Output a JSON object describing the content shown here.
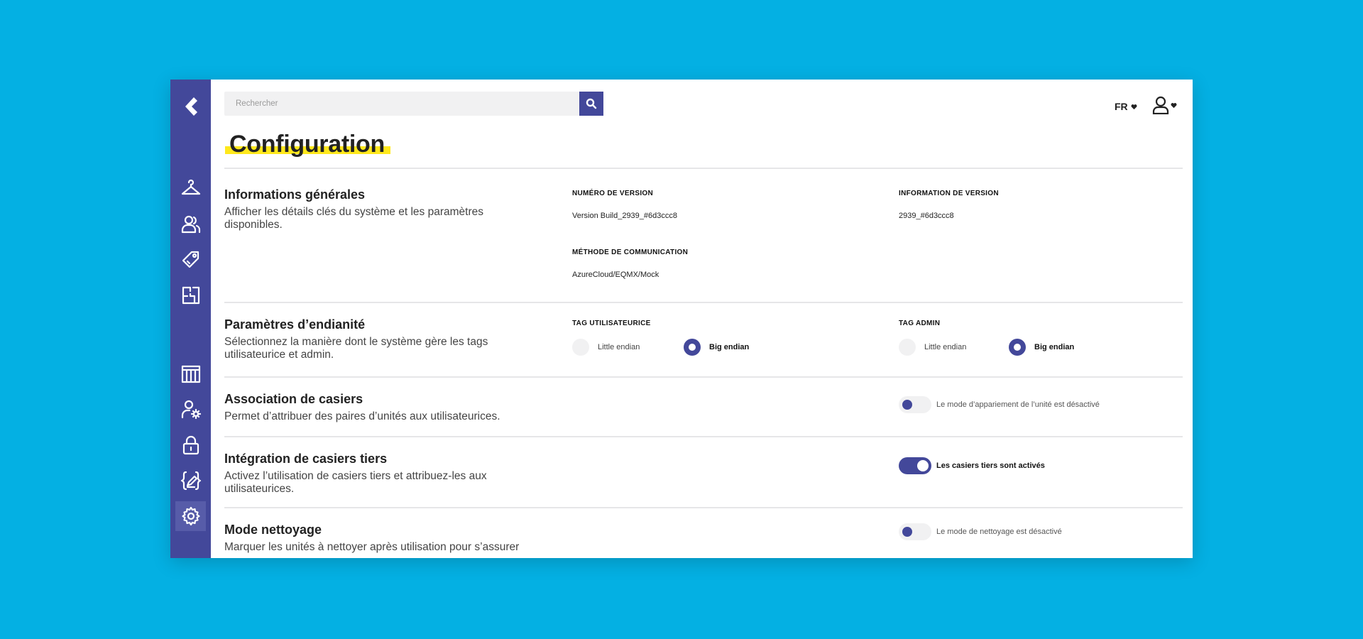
{
  "search": {
    "placeholder": "Rechercher"
  },
  "header": {
    "language": "FR"
  },
  "page": {
    "title": "Configuration"
  },
  "sections": {
    "general": {
      "title": "Informations générales",
      "description": "Afficher les détails clés du système et les paramètres disponibles.",
      "version_number_label": "NUMÉRO DE VERSION",
      "version_number_value": "Version Build_2939_#6d3ccc8",
      "version_info_label": "INFORMATION DE VERSION",
      "version_info_value": "2939_#6d3ccc8",
      "communication_label": "MÉTHODE DE COMMUNICATION",
      "communication_value": "AzureCloud/EQMX/Mock"
    },
    "endian": {
      "title": "Paramètres d’endianité",
      "description": "Sélectionnez la manière dont le système gère les tags utilisateurice et admin.",
      "user_tag": {
        "label": "TAG UTILISATEURICE",
        "options": [
          "Little endian",
          "Big endian"
        ],
        "selected": "Big endian"
      },
      "admin_tag": {
        "label": "TAG ADMIN",
        "options": [
          "Little endian",
          "Big endian"
        ],
        "selected": "Big endian"
      }
    },
    "pairing": {
      "title": "Association de casiers",
      "description": "Permet d’attribuer des paires d’unités aux utilisateurices.",
      "toggle_label": "Le mode d’appariement de l’unité est désactivé",
      "enabled": false
    },
    "third_party": {
      "title": "Intégration de casiers tiers",
      "description": "Activez l’utilisation de casiers tiers et attribuez-les aux utilisateurices.",
      "toggle_label": "Les casiers tiers sont activés",
      "enabled": true
    },
    "cleaning": {
      "title": "Mode nettoyage",
      "description": "Marquer les unités à nettoyer après utilisation pour s’assurer",
      "toggle_label": "Le mode de nettoyage est désactivé",
      "enabled": false
    }
  },
  "sidebar": {
    "icons": [
      "back-chevron-icon",
      "hanger-icon",
      "users-icon",
      "tag-icon",
      "floor-plan-icon",
      "lockers-icon",
      "user-settings-icon",
      "lock-icon",
      "code-edit-icon",
      "gear-icon"
    ],
    "active": "gear-icon"
  },
  "colors": {
    "background": "#04b0e3",
    "primary": "#43489a",
    "highlight": "#ffe81c",
    "muted": "#f1f1f2"
  }
}
